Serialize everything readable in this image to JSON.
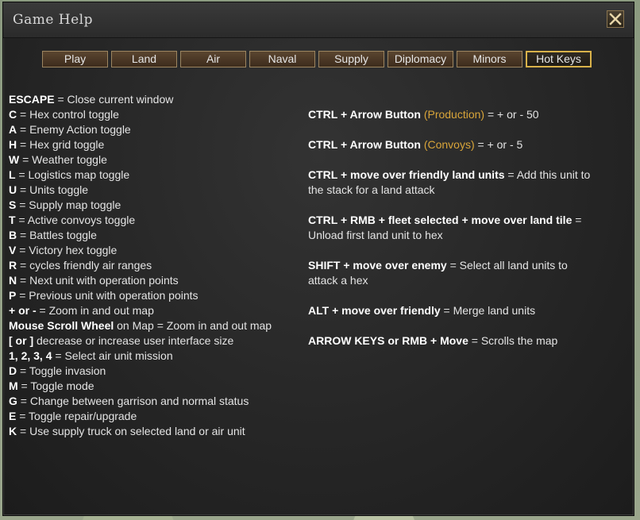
{
  "window": {
    "title": "Game Help"
  },
  "tabs": [
    {
      "label": "Play"
    },
    {
      "label": "Land"
    },
    {
      "label": "Air"
    },
    {
      "label": "Naval"
    },
    {
      "label": "Supply"
    },
    {
      "label": "Diplomacy"
    },
    {
      "label": "Minors"
    },
    {
      "label": "Hot Keys"
    }
  ],
  "active_tab": "Hot Keys",
  "left_hotkeys": [
    {
      "key": "ESCAPE",
      "desc": " = Close current window"
    },
    {
      "key": "C",
      "desc": " = Hex control toggle"
    },
    {
      "key": "A",
      "desc": " = Enemy Action toggle"
    },
    {
      "key": "H",
      "desc": " = Hex grid toggle"
    },
    {
      "key": "W",
      "desc": " = Weather toggle"
    },
    {
      "key": "L",
      "desc": " = Logistics map toggle"
    },
    {
      "key": "U",
      "desc": " = Units toggle"
    },
    {
      "key": "S",
      "desc": " = Supply map toggle"
    },
    {
      "key": "T",
      "desc": " = Active convoys toggle"
    },
    {
      "key": "B",
      "desc": " = Battles toggle"
    },
    {
      "key": "V",
      "desc": " = Victory hex toggle"
    },
    {
      "key": "R",
      "desc": " = cycles friendly air ranges"
    },
    {
      "key": "N",
      "desc": " = Next unit with operation points"
    },
    {
      "key": "P",
      "desc": " = Previous unit with operation points"
    },
    {
      "key": "+ or -",
      "desc": " = Zoom in and out map"
    },
    {
      "key": "Mouse Scroll Wheel",
      "desc": " on Map = Zoom in and out map"
    },
    {
      "key": "[ or ]",
      "desc": " decrease or increase user interface size"
    },
    {
      "key": "1, 2, 3, 4",
      "desc": " = Select air unit mission"
    },
    {
      "key": "D",
      "desc": " = Toggle invasion"
    },
    {
      "key": "M",
      "desc": " = Toggle mode"
    },
    {
      "key": "G",
      "desc": " = Change between garrison and normal status"
    },
    {
      "key": "E",
      "desc": " = Toggle repair/upgrade"
    },
    {
      "key": "K",
      "desc": " = Use supply truck on selected land or air unit"
    }
  ],
  "right_hotkeys": [
    {
      "key": "CTRL + Arrow Button",
      "tag": " (Production)",
      "desc": " = + or - 50",
      "desc2": ""
    },
    {
      "key": "CTRL + Arrow Button",
      "tag": " (Convoys)",
      "desc": " = + or - 5",
      "desc2": ""
    },
    {
      "key": "CTRL + move over friendly land units",
      "tag": "",
      "desc": " = Add this unit to",
      "desc2": "the stack for a land attack"
    },
    {
      "key": "CTRL + RMB + fleet selected + move over land tile",
      "tag": "",
      "desc": " =",
      "desc2": "Unload first land unit to hex"
    },
    {
      "key": "SHIFT + move over enemy",
      "tag": "",
      "desc": " = Select all land units to",
      "desc2": "attack a hex"
    },
    {
      "key": "ALT + move over friendly",
      "tag": "",
      "desc": " = Merge land units",
      "desc2": ""
    },
    {
      "key": "ARROW KEYS or RMB + Move",
      "tag": "",
      "desc": " = Scrolls the map",
      "desc2": ""
    }
  ],
  "colors": {
    "highlight": "#d9a53a",
    "active_tab_border": "#d9b24a",
    "tab_fill": "#4a3825",
    "window_bg": "#2b2b2b"
  },
  "icons": {
    "close": "close-icon"
  }
}
